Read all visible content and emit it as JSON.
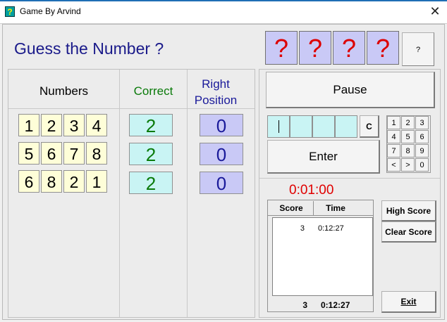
{
  "window": {
    "title": "Game By Arvind",
    "icon_glyph": "?",
    "close_glyph": "✕"
  },
  "heading": "Guess the Number ?",
  "hidden_digits": [
    "?",
    "?",
    "?",
    "?"
  ],
  "help_button": "?",
  "columns": {
    "numbers": "Numbers",
    "correct": "Correct",
    "right_position": [
      "Right",
      "Position"
    ]
  },
  "guesses": [
    {
      "digits": [
        "1",
        "2",
        "3",
        "4"
      ],
      "correct": "2",
      "position": "0"
    },
    {
      "digits": [
        "5",
        "6",
        "7",
        "8"
      ],
      "correct": "2",
      "position": "0"
    },
    {
      "digits": [
        "6",
        "8",
        "2",
        "1"
      ],
      "correct": "2",
      "position": "0"
    }
  ],
  "pause_button": "Pause",
  "clear_button": "C",
  "enter_button": "Enter",
  "keypad": [
    "1",
    "2",
    "3",
    "4",
    "5",
    "6",
    "7",
    "8",
    "9",
    "<",
    ">",
    "0"
  ],
  "timer": "0:01:00",
  "score_table": {
    "headers": {
      "score": "Score",
      "time": "Time"
    },
    "rows": [
      {
        "score": "3",
        "time": "0:12:27"
      }
    ],
    "footer": {
      "score": "3",
      "time": "0:12:27"
    }
  },
  "high_score_button": "High Score",
  "clear_score_button": "Clear Score",
  "exit_button": "Exit",
  "colors": {
    "heading": "#1a1a8a",
    "correct": "#0a7a0a",
    "position": "#1a1a9a",
    "question_mark": "#dd0000",
    "timer": "#e00000"
  }
}
